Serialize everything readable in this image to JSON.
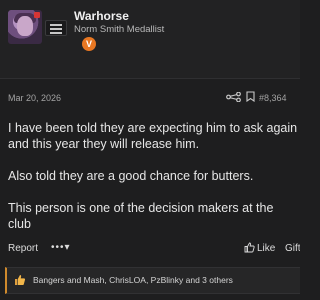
{
  "author": {
    "name": "Warhorse",
    "title": "Norm Smith Medallist",
    "badge_letter": "V",
    "badge_color": "#e87722"
  },
  "post": {
    "date": "Mar 20, 2026",
    "number": "#8,364",
    "paragraphs": [
      "I have been told they are expecting him to ask again and this year they will release him.",
      "Also told they are a good chance for butters.",
      "This person is one of the decision makers at the club"
    ]
  },
  "actions": {
    "report": "Report",
    "more": "•••▾",
    "like": "Like",
    "gift": "Gift"
  },
  "reactions": {
    "users": [
      "Bangers and Mash",
      "ChrisLOA",
      "PzBlinky"
    ],
    "others": "and 3 others",
    "accent_color": "#d08a2c"
  },
  "icons": {
    "menu": "hamburger-menu-icon",
    "share": "share-icon",
    "bookmark": "bookmark-icon",
    "like": "thumbs-up-icon",
    "reaction": "thumbs-up-reaction-icon"
  }
}
